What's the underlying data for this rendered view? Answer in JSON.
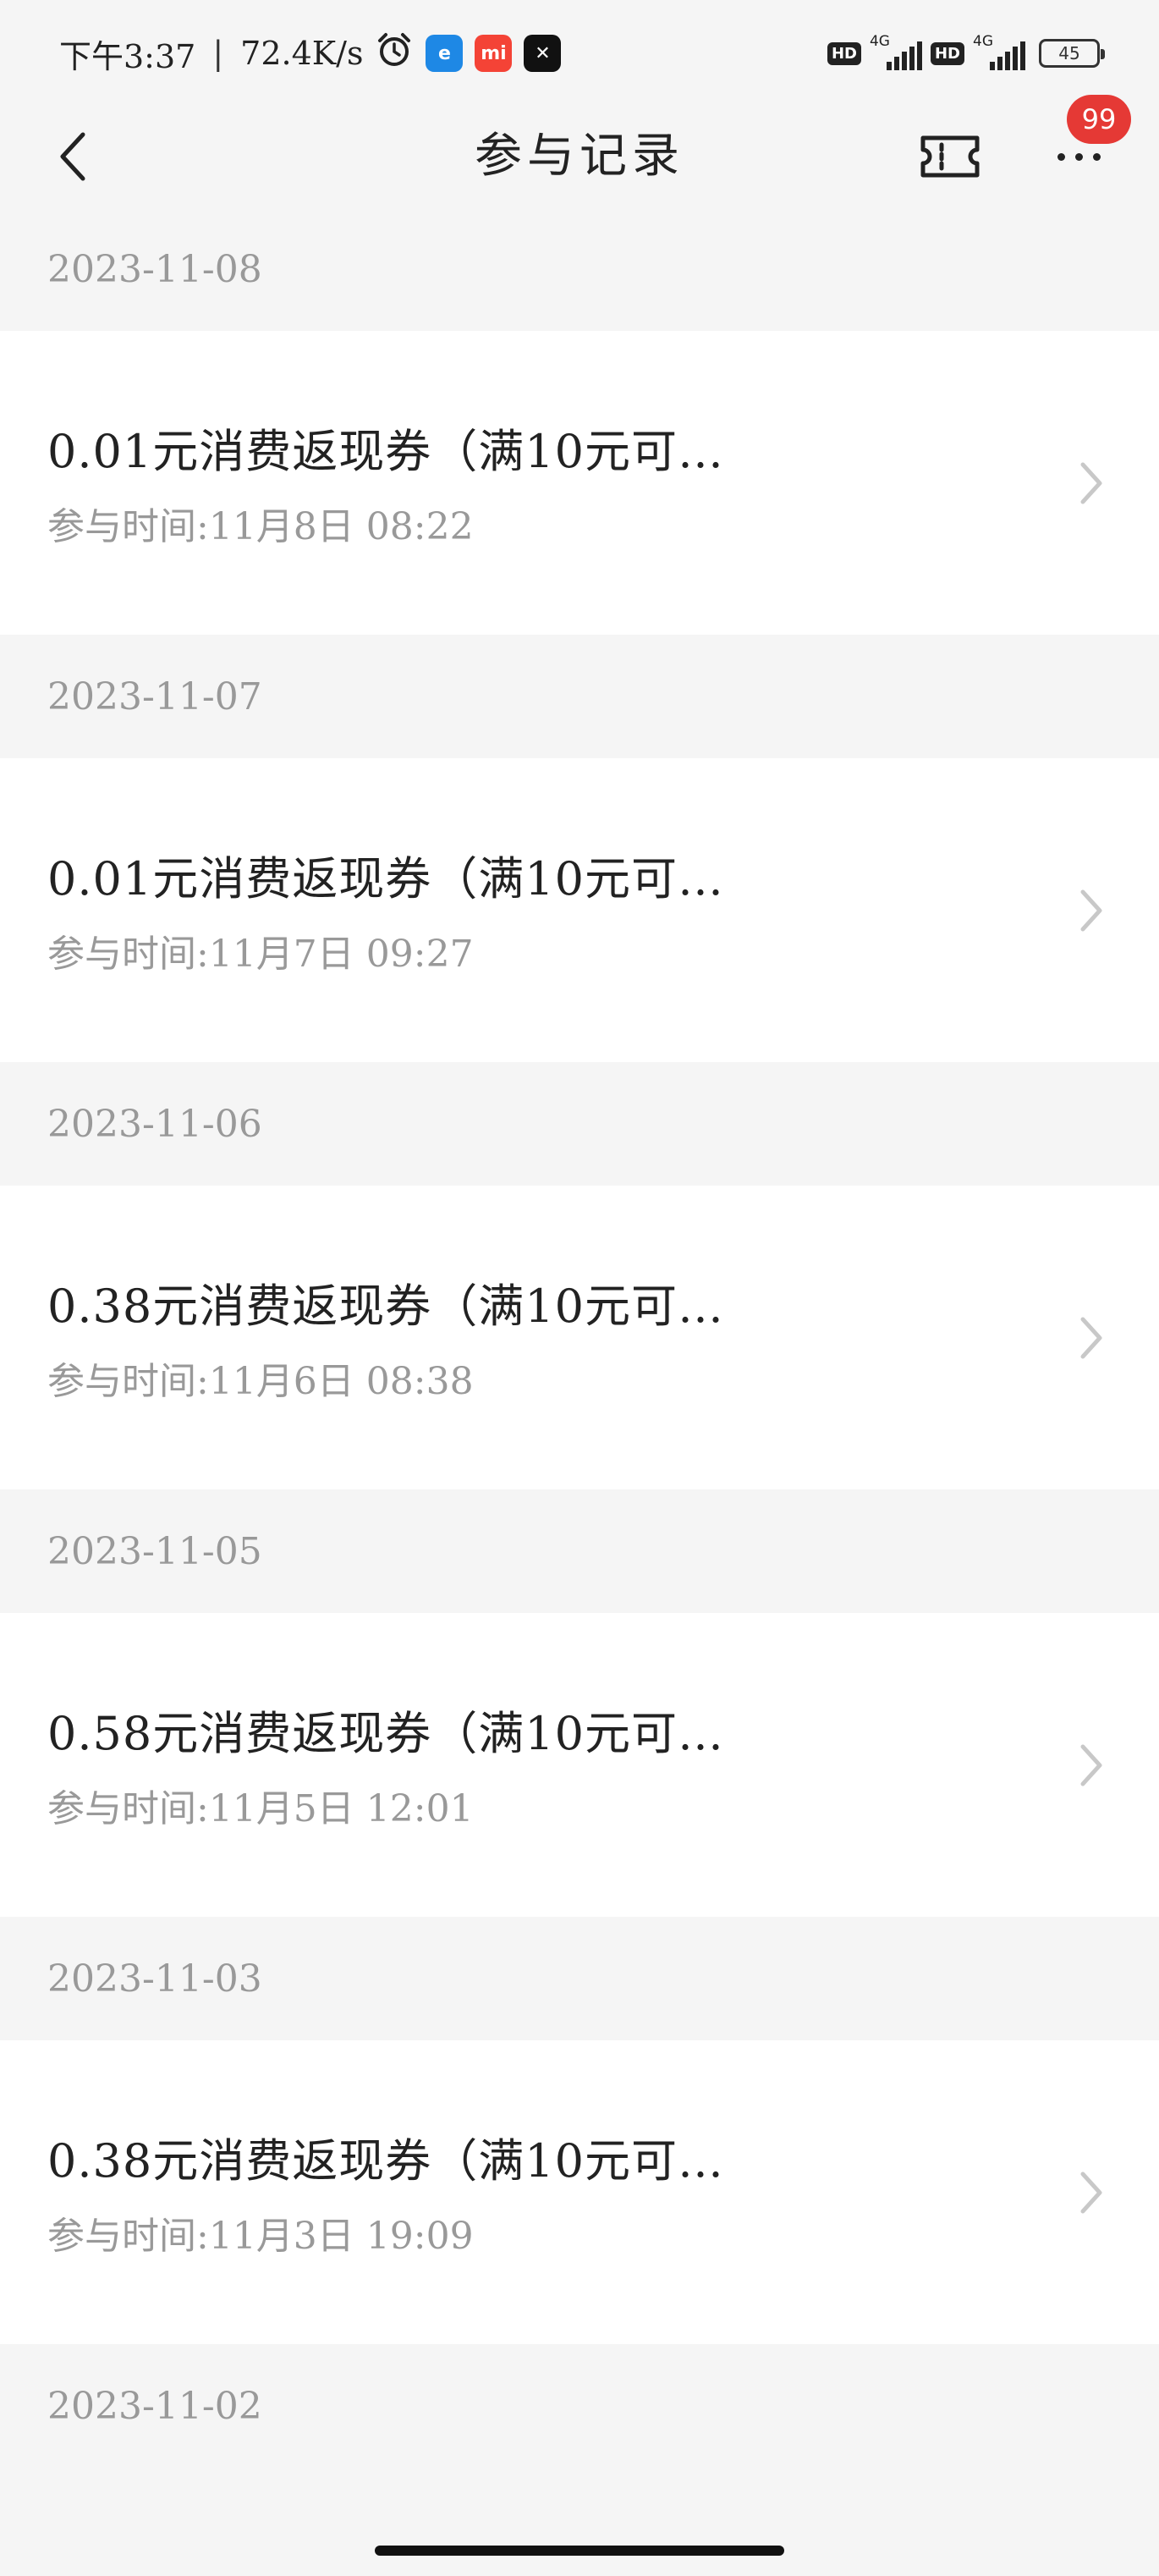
{
  "status_bar": {
    "time": "下午3:37",
    "net_speed": "72.4K/s",
    "app_icons": [
      {
        "name": "alarm-icon"
      },
      {
        "name": "browser-app-icon",
        "color": "#1e88e5",
        "glyph": "e"
      },
      {
        "name": "mi-store-app-icon",
        "color": "#f44336",
        "glyph": "mi"
      },
      {
        "name": "capcut-app-icon",
        "color": "#111111",
        "glyph": "✕"
      }
    ],
    "sim1": {
      "hd": "HD",
      "network": "4G"
    },
    "sim2": {
      "hd": "HD",
      "network": "4G"
    },
    "battery": "45"
  },
  "nav": {
    "title": "参与记录",
    "badge_count": "99"
  },
  "records": [
    {
      "date": "2023-11-08",
      "title": "0.01元消费返现券（满10元可…",
      "time": "参与时间:11月8日  08:22"
    },
    {
      "date": "2023-11-07",
      "title": "0.01元消费返现券（满10元可…",
      "time": "参与时间:11月7日  09:27"
    },
    {
      "date": "2023-11-06",
      "title": "0.38元消费返现券（满10元可…",
      "time": "参与时间:11月6日  08:38"
    },
    {
      "date": "2023-11-05",
      "title": "0.58元消费返现券（满10元可…",
      "time": "参与时间:11月5日  12:01"
    },
    {
      "date": "2023-11-03",
      "title": "0.38元消费返现券（满10元可…",
      "time": "参与时间:11月3日  19:09"
    }
  ],
  "trailing_date": "2023-11-02",
  "colors": {
    "page_bg": "#f5f5f5",
    "card_bg": "#ffffff",
    "badge": "#e53935",
    "secondary_text": "#999999"
  }
}
